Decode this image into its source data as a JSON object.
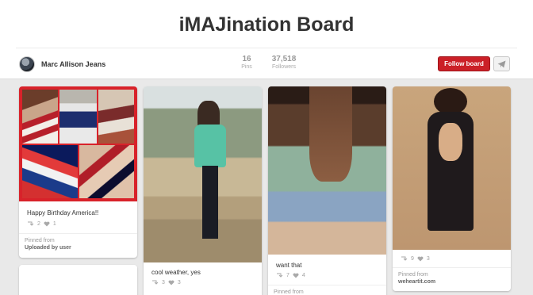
{
  "board": {
    "title": "iMAJination Board",
    "owner": "Marc Allison Jeans",
    "pins_count": "16",
    "pins_label": "Pins",
    "followers_count": "37,518",
    "followers_label": "Followers",
    "follow_label": "Follow board"
  },
  "pins": [
    {
      "description": "Happy Birthday America!!",
      "repins": "2",
      "likes": "1",
      "pinned_from_label": "Pinned from",
      "source": "Uploaded by user"
    },
    {
      "description": "cool weather, yes",
      "repins": "3",
      "likes": "3"
    },
    {
      "description": "want that",
      "repins": "7",
      "likes": "4",
      "pinned_from_label": "Pinned from"
    },
    {
      "repins": "9",
      "likes": "3",
      "pinned_from_label": "Pinned from",
      "source": "weheartit.com"
    }
  ],
  "colors": {
    "follow_button": "#cb2027",
    "background": "#e9e9e9",
    "collage_border": "#d8222a"
  },
  "icons": [
    "repin-icon",
    "heart-icon",
    "send-icon",
    "avatar"
  ]
}
